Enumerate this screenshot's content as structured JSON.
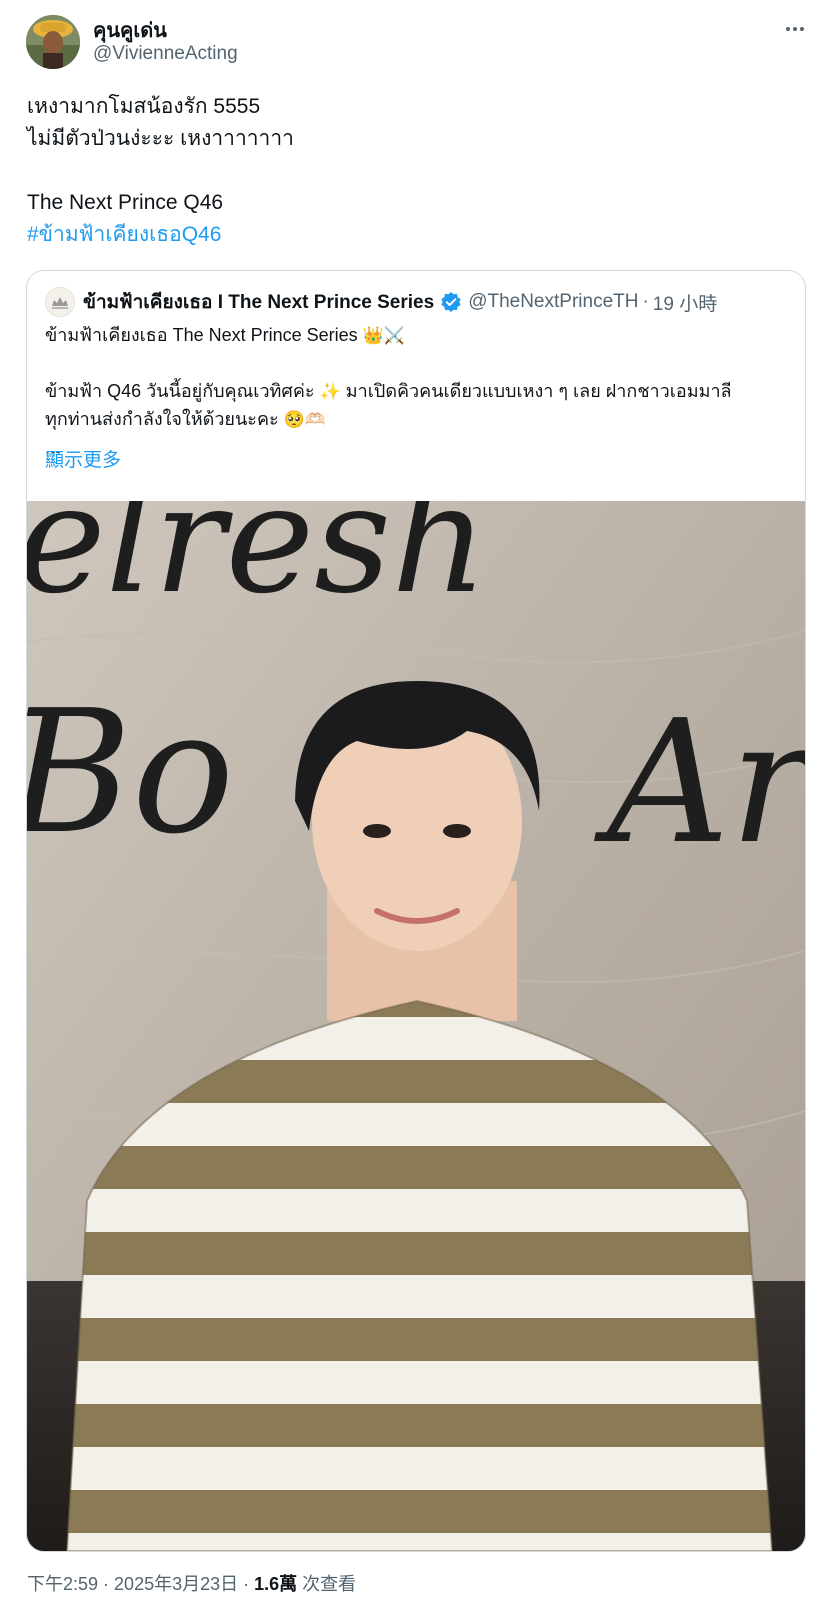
{
  "author": {
    "name": "คุนคูเด่น",
    "handle": "@VivienneActing",
    "avatar_icon": "profile-photo"
  },
  "more_icon": "more-horizontal-icon",
  "tweet": {
    "lines": [
      "เหงามากโมสน้องรัก 5555",
      "ไม่มีตัวป่วนง่ะะะ เหงาาาาาาา",
      "",
      "The Next Prince Q46"
    ],
    "hashtag": "#ข้ามฟ้าเคียงเธอQ46"
  },
  "quote": {
    "avatar_icon": "series-logo-icon",
    "name": "ข้ามฟ้าเคียงเธอ I The Next Prince Series",
    "verified_icon": "verified-badge-icon",
    "handle": "@TheNextPrinceTH",
    "separator": "·",
    "time": "19 小時",
    "line1": "ข้ามฟ้าเคียงเธอ The Next Prince Series",
    "line1_emojis": "👑⚔️",
    "line2_a": "ข้ามฟ้า Q46 วันนี้อยู่กับคุณเวทิศค่ะ",
    "line2_emoji": "✨",
    "line2_b": "มาเปิดคิวคนเดียวแบบเหงา ๆ เลย ฝากชาวเอมมาลี",
    "line3": "ทุกท่านส่งกำลังใจให้ด้วยนะคะ",
    "line3_emojis": "🥺🫶🏻",
    "ellipsis": "...",
    "show_more": "顯示更多",
    "photo_text_top": "elresh",
    "photo_text_mid": "Bo",
    "photo_text_right": "Ar"
  },
  "meta": {
    "time": "下午2:59",
    "sep1": " · ",
    "date": "2025年3月23日",
    "sep2": " · ",
    "views_count": "1.6萬",
    "views_label": " 次查看"
  },
  "colors": {
    "accent": "#1d9bf0",
    "secondary_text": "#536471",
    "primary_text": "#0f1419",
    "border": "#cfd9de"
  }
}
